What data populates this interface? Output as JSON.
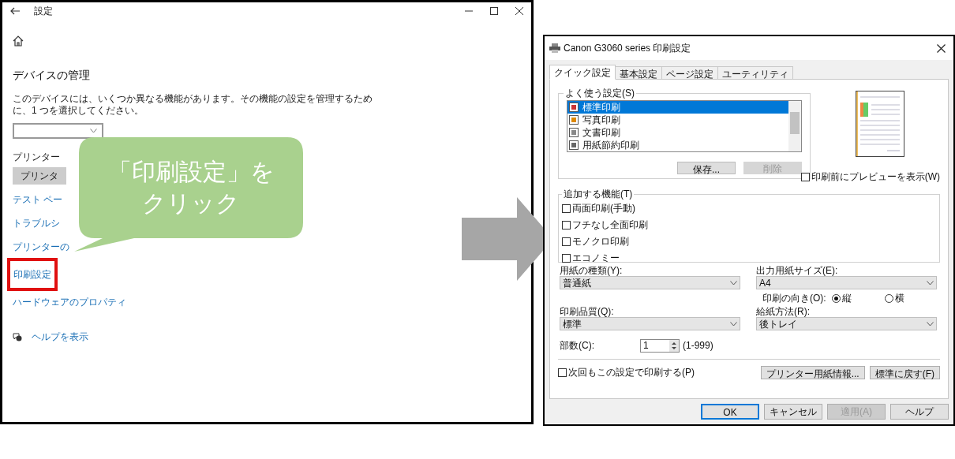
{
  "settings_window": {
    "title": "設定",
    "heading": "デバイスの管理",
    "description": "このデバイスには、いくつか異なる機能があります。その機能の設定を管理するために、1 つを選択してください。",
    "printer_label": "プリンター",
    "printer_button": "プリンタ",
    "links": [
      {
        "label": "テスト ペー",
        "highlighted": false
      },
      {
        "label": "トラブルシ",
        "highlighted": false
      },
      {
        "label": "プリンターの",
        "highlighted": false
      },
      {
        "label": "印刷設定",
        "highlighted": true
      },
      {
        "label": "ハードウェアのプロパティ",
        "highlighted": false
      }
    ],
    "help_link": "ヘルプを表示"
  },
  "callout": {
    "lines": [
      "「印刷設定」を",
      "クリック"
    ]
  },
  "print_dialog": {
    "title": "Canon G3060 series 印刷設定",
    "tabs": [
      {
        "label": "クイック設定",
        "selected": true
      },
      {
        "label": "基本設定",
        "selected": false
      },
      {
        "label": "ページ設定",
        "selected": false
      },
      {
        "label": "ユーティリティ",
        "selected": false
      }
    ],
    "favorites": {
      "label": "よく使う設定(S)",
      "items": [
        {
          "label": "標準印刷",
          "selected": true
        },
        {
          "label": "写真印刷",
          "selected": false
        },
        {
          "label": "文書印刷",
          "selected": false
        },
        {
          "label": "用紙節約印刷",
          "selected": false
        }
      ],
      "buttons": [
        {
          "label": "保存...",
          "disabled": false
        },
        {
          "label": "削除",
          "disabled": true
        }
      ]
    },
    "preview_checkbox": {
      "label": "印刷前にプレビューを表示(W)",
      "checked": false
    },
    "features": {
      "label": "追加する機能(T)",
      "options": [
        {
          "label": "両面印刷(手動)",
          "checked": false
        },
        {
          "label": "フチなし全面印刷",
          "checked": false
        },
        {
          "label": "モノクロ印刷",
          "checked": false
        },
        {
          "label": "エコノミー",
          "checked": false
        }
      ]
    },
    "paper_type": {
      "label": "用紙の種類(Y):",
      "value": "普通紙"
    },
    "output_size": {
      "label": "出力用紙サイズ(E):",
      "value": "A4"
    },
    "orientation": {
      "label": "印刷の向き(O):",
      "options": [
        {
          "label": "縦",
          "selected": true
        },
        {
          "label": "横",
          "selected": false
        }
      ]
    },
    "quality": {
      "label": "印刷品質(Q):",
      "value": "標準"
    },
    "paper_source": {
      "label": "給紙方法(R):",
      "value": "後トレイ"
    },
    "copies": {
      "label": "部数(C):",
      "value": "1",
      "range": "(1-999)"
    },
    "remember_checkbox": {
      "label": "次回もこの設定で印刷する(P)",
      "checked": false
    },
    "side_buttons": [
      {
        "label": "プリンター用紙情報...",
        "disabled": false
      },
      {
        "label": "標準に戻す(F)",
        "disabled": false
      }
    ],
    "footer_buttons": [
      {
        "label": "OK",
        "disabled": false,
        "default": true
      },
      {
        "label": "キャンセル",
        "disabled": false,
        "default": false
      },
      {
        "label": "適用(A)",
        "disabled": true,
        "default": false
      },
      {
        "label": "ヘルプ",
        "disabled": false,
        "default": false
      }
    ]
  }
}
